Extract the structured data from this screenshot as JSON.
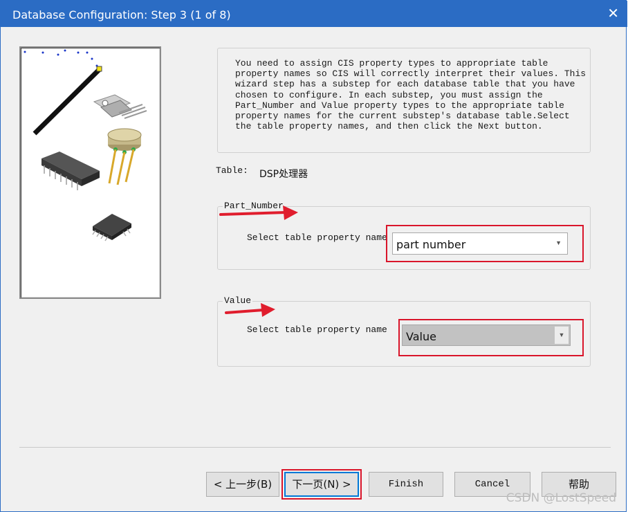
{
  "window": {
    "title": "Database Configuration: Step 3 (1 of 8)"
  },
  "info_text": "You need to assign CIS property types to appropriate table property names so CIS will correctly interpret their values. This wizard step has a substep for each database table that you have chosen to configure. In each substep, you must assign the Part_Number and Value property types to the appropriate table property names for the current substep's database table.Select the table property names, and then click the Next button.",
  "table": {
    "label": "Table:",
    "value": "DSP处理器"
  },
  "part_number_group": {
    "legend": "Part_Number",
    "prompt": "Select table property name",
    "selected": "part number"
  },
  "value_group": {
    "legend": "Value",
    "prompt": "Select table property name",
    "selected": "Value"
  },
  "buttons": {
    "back": "< 上一步(B)",
    "next": "下一页(N) >",
    "finish": "Finish",
    "cancel": "Cancel",
    "help": "帮助"
  },
  "watermark": "CSDN @LostSpeed",
  "colors": {
    "titlebar": "#2b6cc4",
    "highlight": "#d9152a",
    "focus": "#0078d7"
  }
}
